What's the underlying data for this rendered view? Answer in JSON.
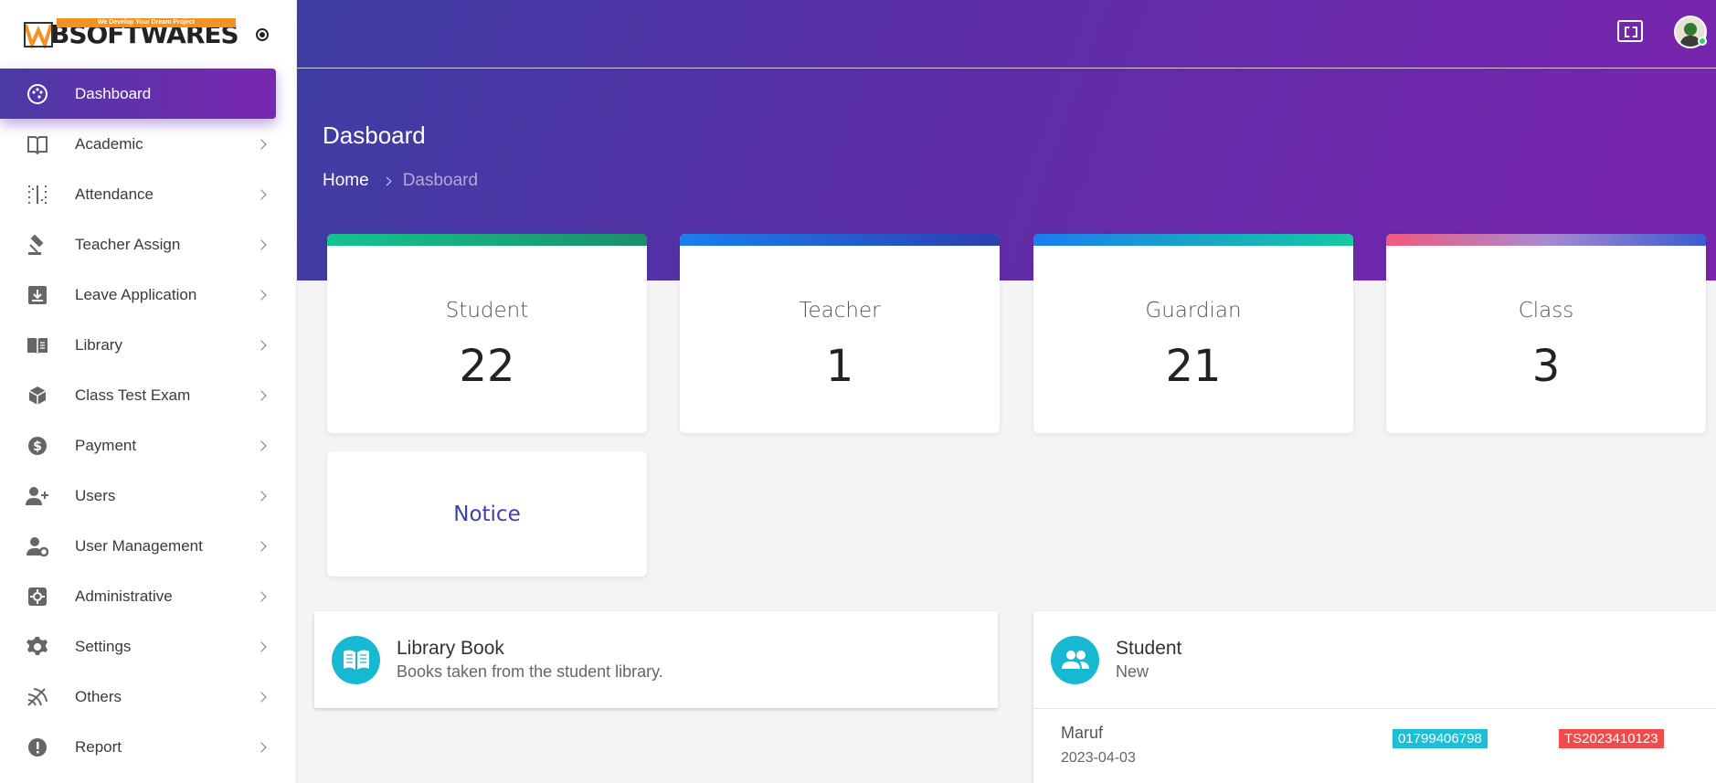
{
  "brand": {
    "name": "BSOFTWARES",
    "tagline": "We Develop Your Dream Project"
  },
  "sidebar": {
    "items": [
      {
        "label": "Dashboard",
        "icon": "palette-icon"
      },
      {
        "label": "Academic",
        "icon": "book-icon"
      },
      {
        "label": "Attendance",
        "icon": "grid-dots-icon"
      },
      {
        "label": "Teacher Assign",
        "icon": "gavel-icon"
      },
      {
        "label": "Leave Application",
        "icon": "inbox-download-icon"
      },
      {
        "label": "Library",
        "icon": "book-open-icon"
      },
      {
        "label": "Class Test Exam",
        "icon": "cube-icon"
      },
      {
        "label": "Payment",
        "icon": "dollar-icon"
      },
      {
        "label": "Users",
        "icon": "user-plus-icon"
      },
      {
        "label": "User Management",
        "icon": "user-gear-icon"
      },
      {
        "label": "Administrative",
        "icon": "settings-box-icon"
      },
      {
        "label": "Settings",
        "icon": "gear-icon"
      },
      {
        "label": "Others",
        "icon": "signal-icon"
      },
      {
        "label": "Report",
        "icon": "alert-circle-icon"
      }
    ]
  },
  "header": {
    "title": "Dasboard",
    "breadcrumb": {
      "home": "Home",
      "current": "Dasboard"
    }
  },
  "stats": [
    {
      "label": "Student",
      "value": "22",
      "color": "#1db37a"
    },
    {
      "label": "Teacher",
      "value": "1",
      "color": "#2a56d6"
    },
    {
      "label": "Guardian",
      "value": "21",
      "color": "#16c3a0"
    },
    {
      "label": "Class",
      "value": "3",
      "color": "#f0577a"
    }
  ],
  "notice": {
    "label": "Notice"
  },
  "library_panel": {
    "title": "Library Book",
    "subtitle": "Books taken from the student library."
  },
  "student_panel": {
    "title": "Student",
    "subtitle": "New",
    "rows": [
      {
        "name": "Maruf",
        "date": "2023-04-03",
        "phone": "01799406798",
        "id": "TS2023410123"
      }
    ]
  }
}
